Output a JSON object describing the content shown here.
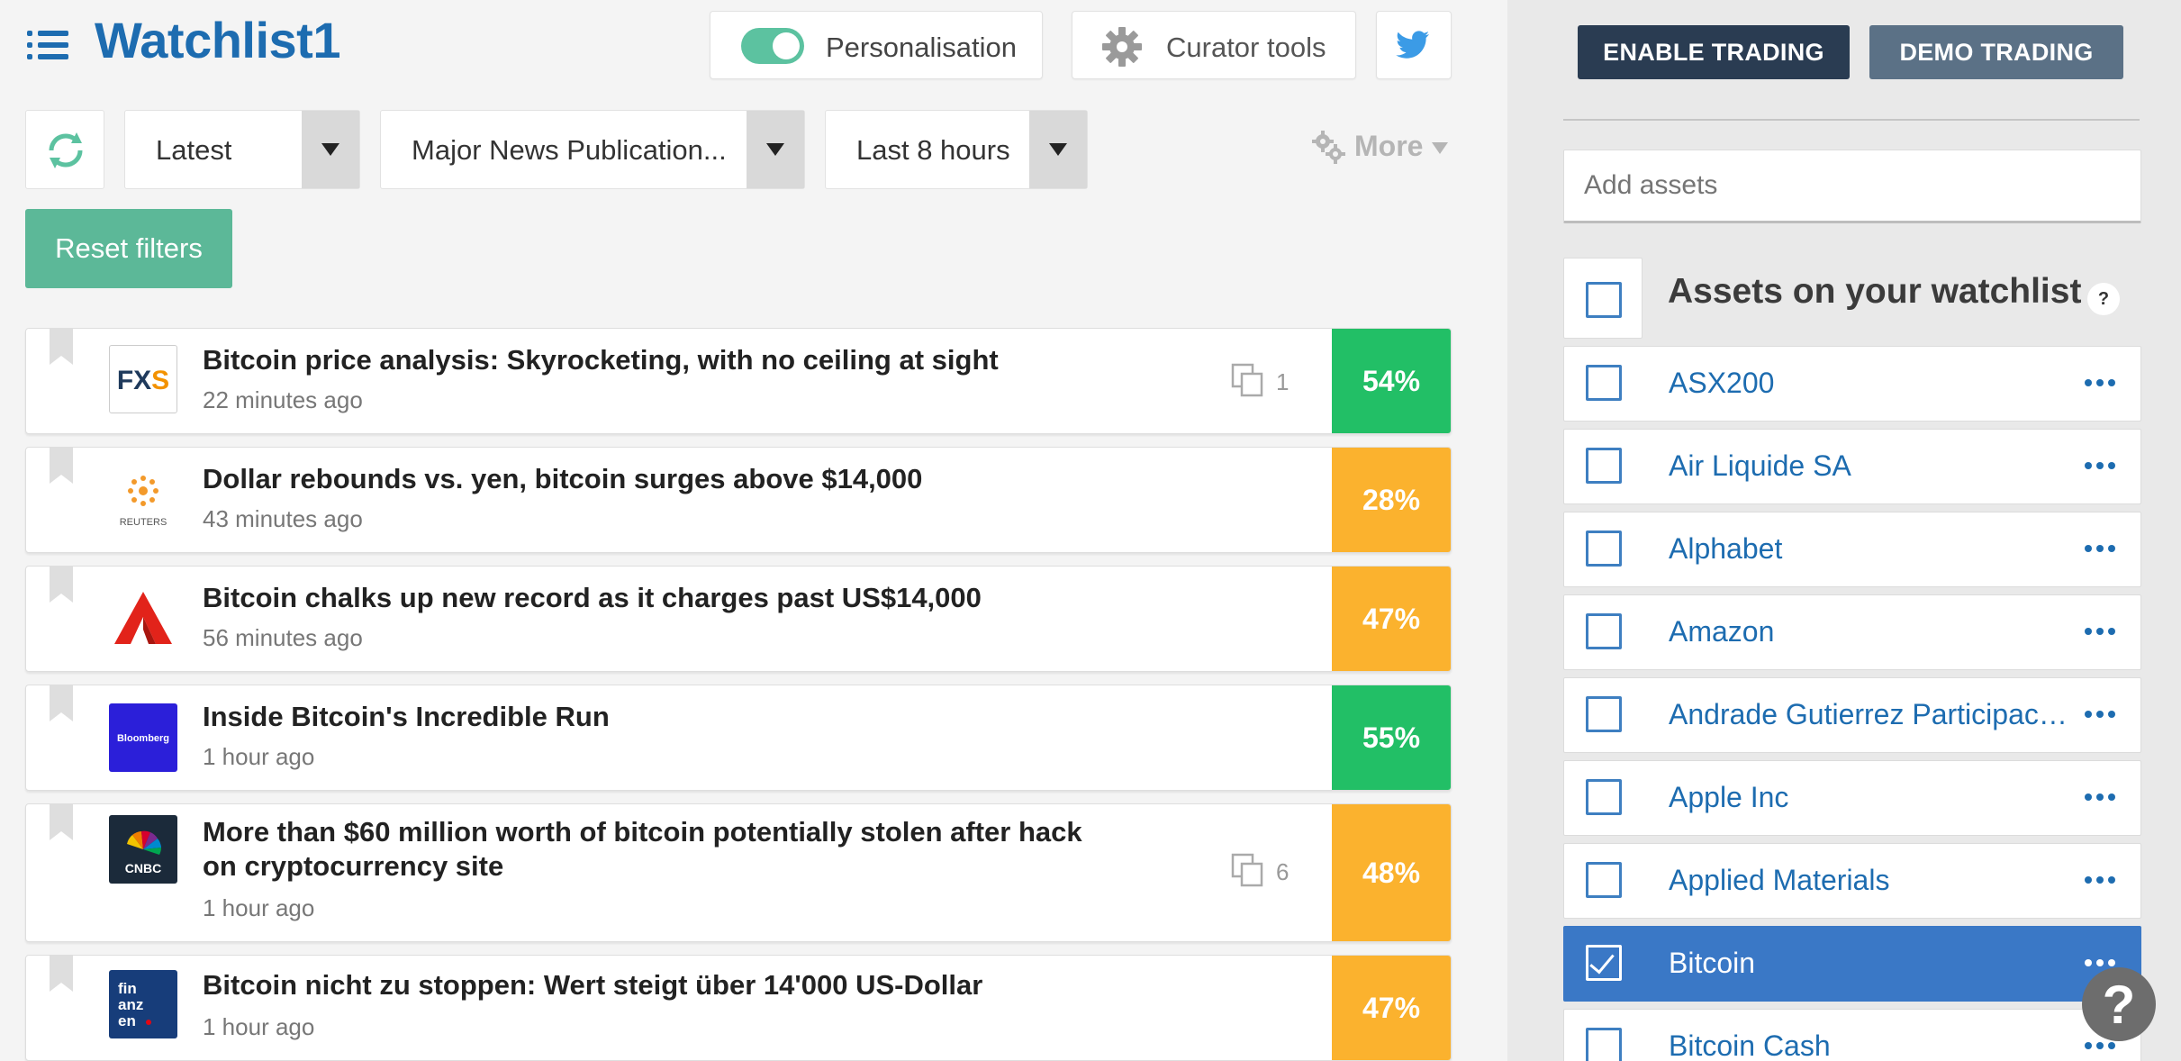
{
  "header": {
    "title": "Watchlist1",
    "personalisation_label": "Personalisation",
    "curator_label": "Curator tools"
  },
  "filters": {
    "sort": "Latest",
    "sources": "Major News Publication...",
    "time_range": "Last 8 hours",
    "more_label": "More",
    "reset_label": "Reset filters"
  },
  "news": [
    {
      "title": "Bitcoin price analysis: Skyrocketing, with no ceiling at sight",
      "time": "22 minutes ago",
      "dup_count": "1",
      "score": "54%",
      "score_color": "#22bf66",
      "source": "FXS"
    },
    {
      "title": "Dollar rebounds vs. yen, bitcoin surges above $14,000",
      "time": "43 minutes ago",
      "dup_count": "",
      "score": "28%",
      "score_color": "#fbb22e",
      "source": "REUTERS"
    },
    {
      "title": "Bitcoin chalks up new record as it charges past US$14,000",
      "time": "56 minutes ago",
      "dup_count": "",
      "score": "47%",
      "score_color": "#fbb22e",
      "source": "Channel NewsAsia"
    },
    {
      "title": "Inside Bitcoin's Incredible Run",
      "time": "1 hour ago",
      "dup_count": "",
      "score": "55%",
      "score_color": "#22bf66",
      "source": "Bloomberg"
    },
    {
      "title": "More than $60 million worth of bitcoin potentially stolen after hack on cryptocurrency site",
      "time": "1 hour ago",
      "dup_count": "6",
      "score": "48%",
      "score_color": "#fbb22e",
      "source": "CNBC"
    },
    {
      "title": "Bitcoin nicht zu stoppen: Wert steigt über 14'000 US-Dollar",
      "time": "1 hour ago",
      "dup_count": "",
      "score": "47%",
      "score_color": "#fbb22e",
      "source": "fin anz en"
    }
  ],
  "sidebar": {
    "enable_trading": "ENABLE TRADING",
    "demo_trading": "DEMO TRADING",
    "add_assets_placeholder": "Add assets",
    "assets_title": "Assets on your watchlist",
    "help": "?",
    "assets": [
      {
        "name": "ASX200",
        "checked": false
      },
      {
        "name": "Air Liquide SA",
        "checked": false
      },
      {
        "name": "Alphabet",
        "checked": false
      },
      {
        "name": "Amazon",
        "checked": false
      },
      {
        "name": "Andrade Gutierrez Participacoes",
        "checked": false
      },
      {
        "name": "Apple Inc",
        "checked": false
      },
      {
        "name": "Applied Materials",
        "checked": false
      },
      {
        "name": "Bitcoin",
        "checked": true
      },
      {
        "name": "Bitcoin Cash",
        "checked": false
      }
    ]
  },
  "help_fab": "?",
  "colors": {
    "brand": "#1d6cb0",
    "positive": "#22bf66",
    "neutral": "#fbb22e",
    "selected": "#3a78c6",
    "reset": "#5cb898"
  }
}
